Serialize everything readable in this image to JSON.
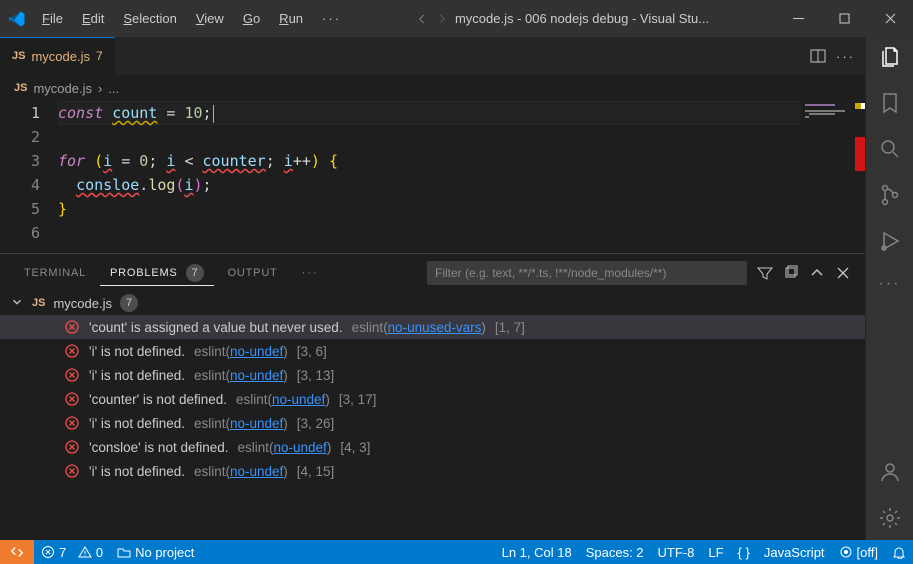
{
  "window": {
    "title": "mycode.js - 006 nodejs debug - Visual Stu..."
  },
  "menu": {
    "items": [
      {
        "label": "File",
        "mnemonic": "F"
      },
      {
        "label": "Edit",
        "mnemonic": "E"
      },
      {
        "label": "Selection",
        "mnemonic": "S"
      },
      {
        "label": "View",
        "mnemonic": "V"
      },
      {
        "label": "Go",
        "mnemonic": "G"
      },
      {
        "label": "Run",
        "mnemonic": "R"
      }
    ],
    "ellipsis": "···"
  },
  "tabs": {
    "active": {
      "icon": "JS",
      "label": "mycode.js",
      "problems": "7"
    }
  },
  "breadcrumb": {
    "icon": "JS",
    "file": "mycode.js",
    "sep": "›",
    "rest": "..."
  },
  "editor": {
    "lines": [
      "1",
      "2",
      "3",
      "4",
      "5",
      "6"
    ],
    "code": {
      "l1": {
        "kw": "const",
        "sp1": " ",
        "var": "count",
        "sp2": " ",
        "op1": "=",
        "sp3": " ",
        "num": "10",
        "semi": ";"
      },
      "l3": {
        "kw": "for",
        "sp1": " ",
        "lp": "(",
        "i1": "i",
        "sp2": " ",
        "op1": "=",
        "sp3": " ",
        "z": "0",
        "semi1": ";",
        "sp4": " ",
        "i2": "i",
        "sp5": " ",
        "lt": "<",
        "sp6": " ",
        "cnt": "counter",
        "semi2": ";",
        "sp7": " ",
        "i3": "i",
        "pp": "++",
        "rp": ")",
        "sp8": " ",
        "lb": "{"
      },
      "l4": {
        "ind": "  ",
        "obj": "consloe",
        "dot": ".",
        "fn": "log",
        "lp": "(",
        "i": "i",
        "rp": ")",
        "semi": ";"
      },
      "l5": {
        "rb": "}"
      }
    }
  },
  "panel": {
    "tabs": {
      "terminal": "TERMINAL",
      "problems": "PROBLEMS",
      "output": "OUTPUT",
      "badge": "7",
      "ellipsis": "···"
    },
    "filterPlaceholder": "Filter (e.g. text, **/*.ts, !**/node_modules/**)",
    "group": {
      "icon": "JS",
      "file": "mycode.js",
      "count": "7"
    },
    "problems": [
      {
        "msg": "'count' is assigned a value but never used.",
        "src": "eslint",
        "rule": "no-unused-vars",
        "loc": "[1, 7]",
        "sel": true
      },
      {
        "msg": "'i' is not defined.",
        "src": "eslint",
        "rule": "no-undef",
        "loc": "[3, 6]"
      },
      {
        "msg": "'i' is not defined.",
        "src": "eslint",
        "rule": "no-undef",
        "loc": "[3, 13]"
      },
      {
        "msg": "'counter' is not defined.",
        "src": "eslint",
        "rule": "no-undef",
        "loc": "[3, 17]"
      },
      {
        "msg": "'i' is not defined.",
        "src": "eslint",
        "rule": "no-undef",
        "loc": "[3, 26]"
      },
      {
        "msg": "'consloe' is not defined.",
        "src": "eslint",
        "rule": "no-undef",
        "loc": "[4, 3]"
      },
      {
        "msg": "'i' is not defined.",
        "src": "eslint",
        "rule": "no-undef",
        "loc": "[4, 15]"
      }
    ]
  },
  "status": {
    "errors": "7",
    "warnings": "0",
    "project": "No project",
    "pos": "Ln 1, Col 18",
    "spaces": "Spaces: 2",
    "enc": "UTF-8",
    "eol": "LF",
    "braces": "{ }",
    "lang": "JavaScript",
    "screencast": "[off]"
  }
}
